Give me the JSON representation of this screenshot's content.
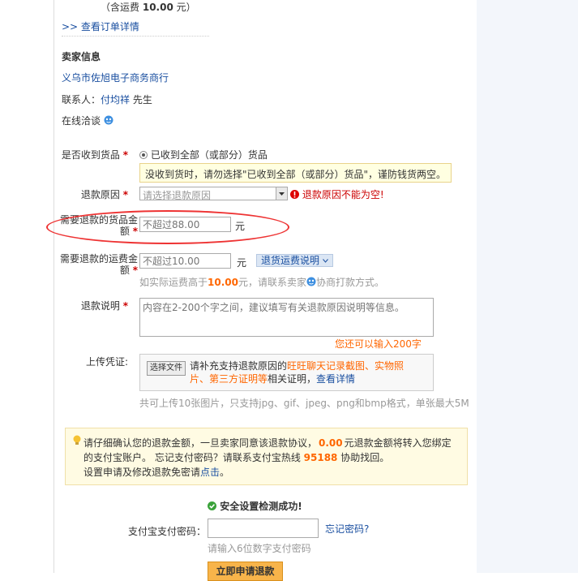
{
  "order": {
    "shipping_prefix": "（含运费",
    "shipping_amount": "10.00",
    "shipping_suffix": "元）",
    "detail_link": ">> 查看订单详情"
  },
  "seller": {
    "heading": "卖家信息",
    "shop_name": "义乌市佐旭电子商务商行",
    "contact_label": "联系人：",
    "contact_name": "付均祥",
    "contact_title": "先生",
    "chat_label": "在线洽谈"
  },
  "form": {
    "received": {
      "label": "是否收到货品",
      "option": "已收到全部（或部分）货品",
      "tip": "没收到货时，请勿选择\"已收到全部（或部分）货品\"，谨防钱货两空。"
    },
    "reason": {
      "label": "退款原因",
      "placeholder": "请选择退款原因",
      "error": "退款原因不能为空!"
    },
    "goods_amount": {
      "label_line1": "需要退款的货品金",
      "label_line2": "额",
      "placeholder": "不超过88.00",
      "unit": "元"
    },
    "shipping_amount": {
      "label_line1": "需要退款的运费金",
      "label_line2": "额",
      "placeholder": "不超过10.00",
      "unit": "元",
      "explain_button": "退货运费说明",
      "hint_prefix": "如实际运费高于",
      "hint_amount": "10.00",
      "hint_mid": "元，请联系卖家",
      "hint_suffix": "协商打款方式。"
    },
    "description": {
      "label": "退款说明",
      "placeholder": "内容在2-200个字之间，建议填写有关退款原因说明等信息。",
      "remaining": "您还可以输入200字"
    },
    "upload": {
      "label": "上传凭证:",
      "button": "选择文件",
      "text_1": "请补充支持退款原因的",
      "link_1": "旺旺聊天记录截图、实物照",
      "link_2": "片、第三方证明等",
      "text_2": "相关证明，",
      "details_link": "查看详情",
      "limit": "共可上传10张图片，只支持jpg、gif、jpeg、png和bmp格式，单张最大5M"
    }
  },
  "notice": {
    "line1_a": "请仔细确认您的退款金额，一旦卖家同意该退款协议，",
    "line1_amount": "0.00",
    "line1_b": "元退款金额将转入您绑定",
    "line2_a": "的支付宝账户。 忘记支付密码？请联系支付宝热线",
    "hotline": "95188",
    "line2_b": "协助找回。",
    "line3_a": "设置申请及修改退款免密请",
    "line3_link": "点击",
    "line3_b": "。"
  },
  "security": {
    "success": "安全设置检测成功!",
    "password_label": "支付宝支付密码：",
    "forgot": "忘记密码?",
    "password_hint": "请输入6位数字支付密码"
  },
  "submit": {
    "label": "立即申请退款"
  },
  "colors": {
    "accent_orange": "#ff6600",
    "error_red": "#cc0000",
    "link_blue": "#1a4fa0",
    "annotation_red": "#e33333"
  }
}
